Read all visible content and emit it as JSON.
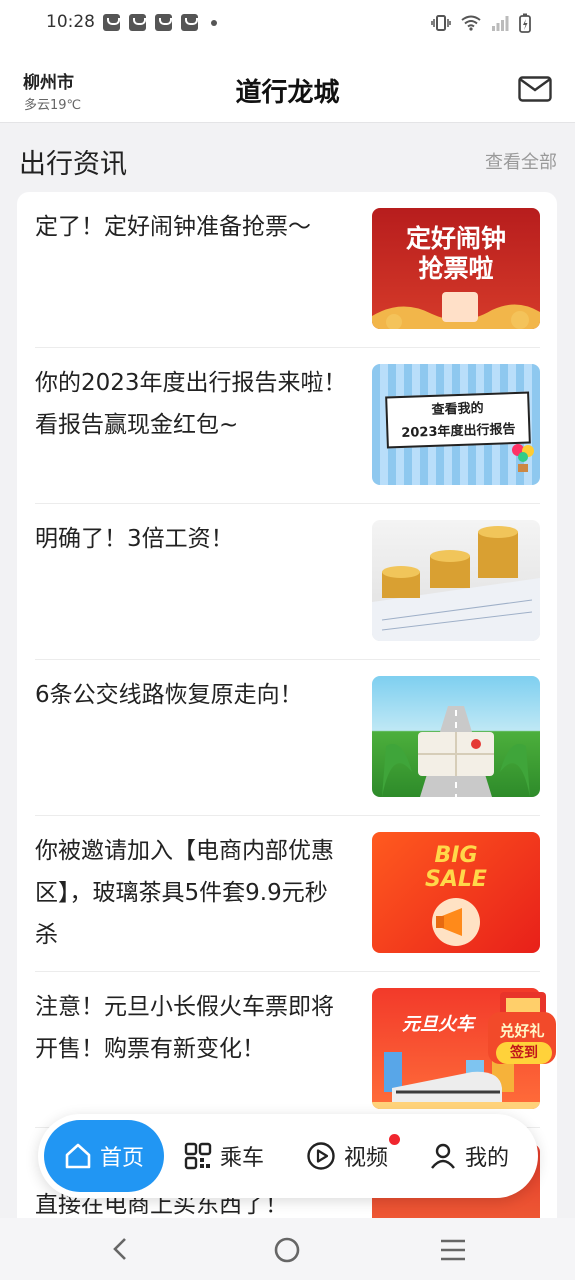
{
  "status_bar": {
    "time": "10:28"
  },
  "header": {
    "city": "柳州市",
    "weather": "多云19℃",
    "title": "道行龙城"
  },
  "section": {
    "title": "出行资讯",
    "more": "查看全部"
  },
  "news": [
    {
      "title": "定了！定好闹钟准备抢票～",
      "thumb_line1": "定好闹钟",
      "thumb_line2": "抢票啦"
    },
    {
      "title": "你的2023年度出行报告来啦！看报告赢现金红包~",
      "thumb_line1": "查看我的",
      "thumb_line2": "2023年度出行报告"
    },
    {
      "title": "明确了！3倍工资！"
    },
    {
      "title": "6条公交线路恢复原走向！"
    },
    {
      "title": "你被邀请加入【电商内部优惠区】，玻璃茶具5件套9.9元秒杀",
      "thumb_line1": "BIG",
      "thumb_line2": "SALE"
    },
    {
      "title": "注意！元旦小长假火车票即将开售！购票有新变化！",
      "thumb_line1": "元旦火车",
      "badge_line1": "兑好礼",
      "badge_line2": "签到"
    },
    {
      "title": "直接在电商上买东西了！"
    }
  ],
  "tabs": [
    {
      "label": "首页",
      "icon": "home-icon"
    },
    {
      "label": "乘车",
      "icon": "qr-code-icon"
    },
    {
      "label": "视频",
      "icon": "play-icon"
    },
    {
      "label": "我的",
      "icon": "user-icon"
    }
  ],
  "colors": {
    "accent": "#2196f3",
    "badge": "#f0262e"
  }
}
